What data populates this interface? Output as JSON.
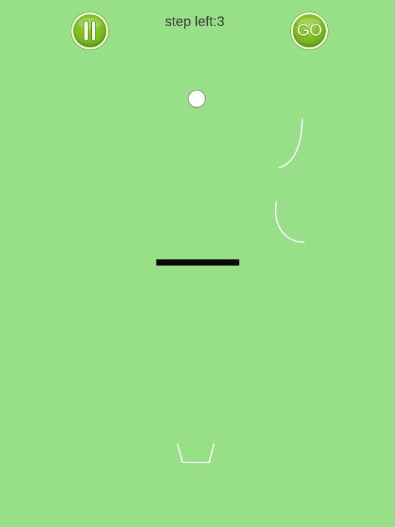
{
  "hud": {
    "steps_text": "step left:3",
    "go_label": "GO"
  },
  "colors": {
    "background": "#98e087",
    "button_green": "#7fbf1f",
    "line": "#ffffff",
    "platform": "#0a0a0a"
  },
  "icons": {
    "pause": "pause-icon"
  }
}
